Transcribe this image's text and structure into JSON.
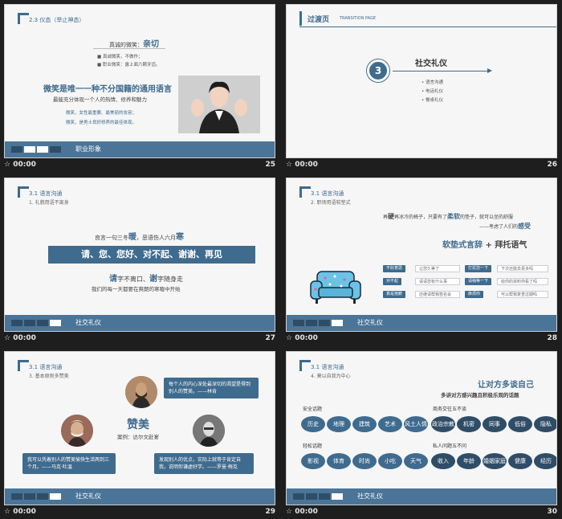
{
  "slides": [
    {
      "number": "25",
      "time": "00:00",
      "section": "2.3 仪态（举止神态）",
      "heading_prefix": "真诚的微笑：",
      "heading_em": "亲切",
      "bullets": [
        "真诚微笑，不做作；",
        "职业微笑：露上面六颗牙齿。"
      ],
      "main": "微笑是唯一一种不分国籍的通用语言",
      "main_sub": "最能充分体现一个人的热情、修养和魅力",
      "note1": "微笑，女性最重要、最美丽的妆容；",
      "note2": "微笑，是男士良好修养的最佳体现。",
      "footer": "职业形象"
    },
    {
      "number": "26",
      "time": "00:00",
      "title": "过渡页",
      "title_en": "TRANSITION PAGE",
      "circle_num": "3",
      "topic": "社交礼仪",
      "items": [
        "语言沟通",
        "电话礼仪",
        "餐桌礼仪"
      ]
    },
    {
      "number": "27",
      "time": "00:00",
      "section": "3.1 语言沟通",
      "sub": "1. 礼貌用语不离身",
      "l1a": "良言一句三冬",
      "l1b": "暖",
      "l1c": "，恶语伤人六月",
      "l1d": "寒",
      "band": "请、您、您好、对不起、谢谢、再见",
      "l3a": "请",
      "l3b": "字不离口、",
      "l3c": "谢",
      "l3d": "字随身走",
      "l4": "我们的每一天都要在爽朗的寒暄中开始",
      "footer": "社交礼仪"
    },
    {
      "number": "28",
      "time": "00:00",
      "section": "3.1 语言沟通",
      "sub": "2. 职场用语软垫式",
      "q1a": "再",
      "q1b": "硬",
      "q1c": "再冰冷的椅子，只要有了",
      "q1d": "柔软",
      "q1e": "的垫子，就可以坐的舒服",
      "q2a": "——考虑了人们的",
      "q2b": "感受",
      "big": "软垫式言辞",
      "big2": " + 拜托语气",
      "pairs": [
        {
          "k": "不好意思",
          "v": "让您久等了"
        },
        {
          "k": "打扰您一下",
          "v": "下次还能去县多吗"
        },
        {
          "k": "对不起",
          "v": "请请您有什么事"
        },
        {
          "k": "请稍等一下",
          "v": "给你的资料你看了吗"
        },
        {
          "k": "真是抱歉",
          "v": "还继请帮我签名会"
        },
        {
          "k": "麻烦你",
          "v": "可以帮我复查过期吗"
        }
      ],
      "footer": "社交礼仪"
    },
    {
      "number": "29",
      "time": "00:00",
      "section": "3.1 语言沟通",
      "sub": "3. 基本原则多赞美",
      "quote_top": "每个人的内心深处最深切的渴望是得到别人的赞美。——林肯",
      "center": "赞美",
      "case": "案例：达尔文赴宴",
      "quote_left": "我可以凭着别人的赞美愉快生活两到三个月。——马克·吐温",
      "quote_right": "发现别人的优点，实际上就等于肯定自我，说明你谦虚好学。——罗曼·梅克",
      "footer": "社交礼仪"
    },
    {
      "number": "30",
      "time": "00:00",
      "section": "3.1 语言沟通",
      "sub": "4. 莫以自我为中心",
      "head1": "让对方多谈自己",
      "head2": "多讲对方感兴趣且积极乐观的话题",
      "safe_label": "安全话题",
      "safe": [
        "历史",
        "地理",
        "建筑",
        "艺术",
        "风土人情"
      ],
      "taboo_label": "商务交往五不谈",
      "taboo": [
        "政治宗教",
        "机密",
        "同事",
        "低俗",
        "隐私"
      ],
      "light_label": "轻松话题",
      "light": [
        "影视",
        "体育",
        "时尚",
        "小吃",
        "天气"
      ],
      "private_label": "私人问题五不问",
      "private": [
        "收入",
        "年龄",
        "婚姻家庭",
        "健康",
        "经历"
      ],
      "footer": "社交礼仪"
    }
  ]
}
